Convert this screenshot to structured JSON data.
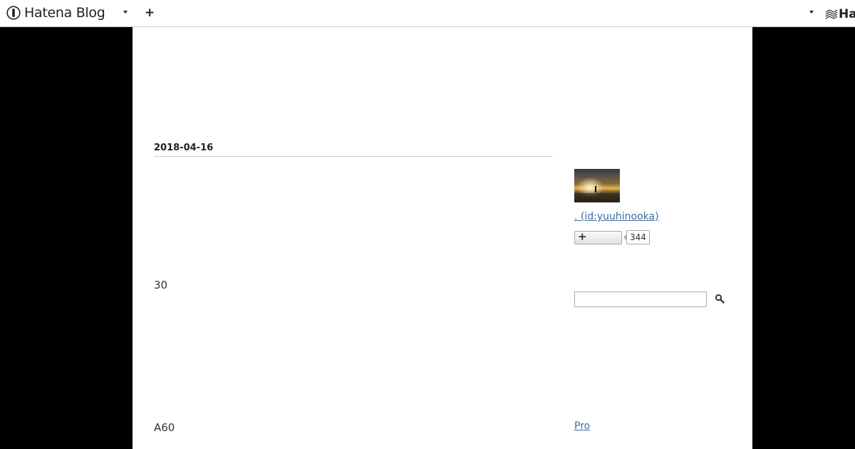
{
  "header": {
    "logo_text": "Hatena Blog",
    "right_brand": "Ha",
    "add_icon": "plus-icon",
    "menu_icon": "chevron-down-icon"
  },
  "entry": {
    "date": "2018-04-16",
    "paragraphs": [
      "30",
      "A60"
    ]
  },
  "sidebar": {
    "profile_link": ". (id:yuuhinooka)",
    "subscribe_count": "344",
    "search_placeholder": "",
    "search_icon": "search-icon",
    "pro_link": "Pro"
  },
  "colors": {
    "background": "#000000",
    "content_bg": "#ffffff",
    "link": "#3b6ea0"
  }
}
